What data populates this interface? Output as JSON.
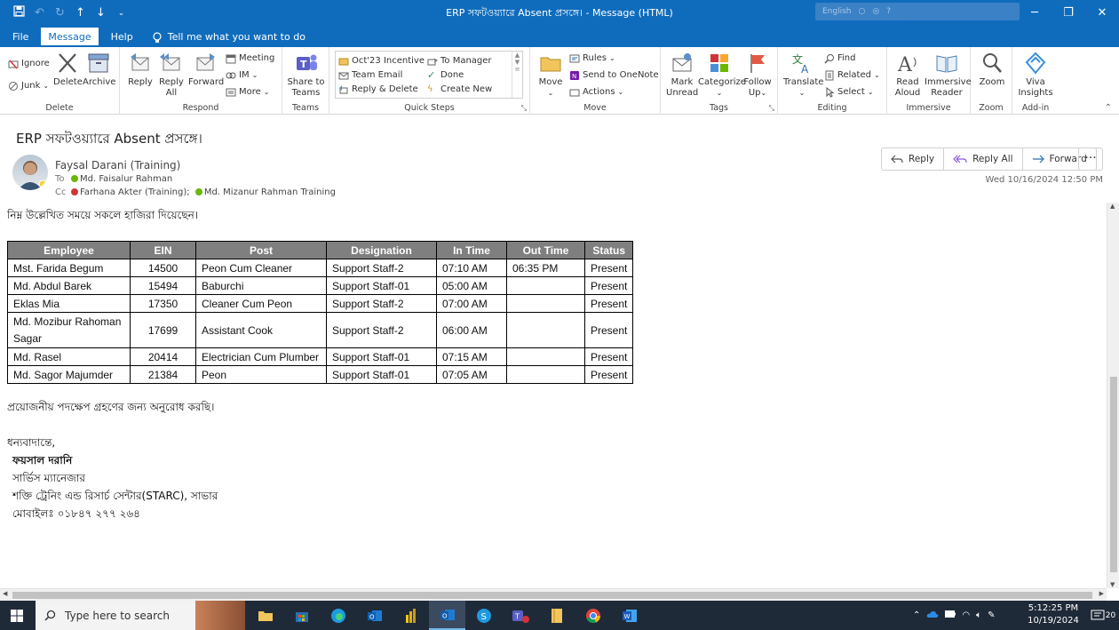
{
  "window": {
    "title": "ERP সফটওয়্যারে Absent প্রসঙ্গে। - Message (HTML)",
    "account_hint": "English"
  },
  "menu": {
    "tabs": [
      "File",
      "Message",
      "Help"
    ],
    "active_tab": "Message",
    "tell_me": "Tell me what you want to do"
  },
  "ribbon": {
    "delete_group": {
      "label": "Delete",
      "ignore": "Ignore",
      "junk": "Junk",
      "delete": "Delete",
      "archive": "Archive"
    },
    "respond_group": {
      "label": "Respond",
      "reply": "Reply",
      "reply_all_1": "Reply",
      "reply_all_2": "All",
      "forward": "Forward",
      "meeting": "Meeting",
      "im": "IM",
      "more": "More"
    },
    "teams_group": {
      "label": "Teams",
      "share_1": "Share to",
      "share_2": "Teams"
    },
    "quicksteps_group": {
      "label": "Quick Steps",
      "items": [
        "Oct'23 Incentive",
        "To Manager",
        "Team Email",
        "Done",
        "Reply & Delete",
        "Create New"
      ]
    },
    "move_group": {
      "label": "Move",
      "move": "Move",
      "rules": "Rules",
      "onenote": "Send to OneNote",
      "actions": "Actions"
    },
    "tags_group": {
      "label": "Tags",
      "mark_1": "Mark",
      "mark_2": "Unread",
      "categorize": "Categorize",
      "follow_1": "Follow",
      "follow_2": "Up"
    },
    "editing_group": {
      "label": "Editing",
      "translate": "Translate",
      "find": "Find",
      "related": "Related",
      "select": "Select"
    },
    "immersive_group": {
      "label": "Immersive",
      "read_1": "Read",
      "read_2": "Aloud",
      "imm_1": "Immersive",
      "imm_2": "Reader"
    },
    "zoom_group": {
      "label": "Zoom",
      "zoom": "Zoom"
    },
    "addin_group": {
      "label": "Add-in",
      "viva_1": "Viva",
      "viva_2": "Insights"
    }
  },
  "message": {
    "subject": "ERP সফটওয়্যারে Absent প্রসঙ্গে।",
    "sender": "Faysal Darani (Training)",
    "to_label": "To",
    "to": "Md. Faisalur Rahman",
    "cc_label": "Cc",
    "cc_1": "Farhana Akter (Training);",
    "cc_2": "Md. Mizanur Rahman Training",
    "timestamp": "Wed 10/16/2024 12:50 PM",
    "actions": {
      "reply": "Reply",
      "reply_all": "Reply All",
      "forward": "Forward",
      "more": "···"
    }
  },
  "body": {
    "intro": "নিম্ন উল্লেখিত সময়ে সকলে হাজিরা দিয়েছেন।",
    "table": {
      "headers": [
        "Employee",
        "EIN",
        "Post",
        "Designation",
        "In Time",
        "Out Time",
        "Status"
      ],
      "rows": [
        [
          "Mst. Farida Begum",
          "14500",
          "Peon Cum Cleaner",
          "Support Staff-2",
          "07:10 AM",
          "06:35 PM",
          "Present"
        ],
        [
          "Md. Abdul Barek",
          "15494",
          "Baburchi",
          "Support Staff-01",
          "05:00 AM",
          "",
          "Present"
        ],
        [
          "Eklas Mia",
          "17350",
          "Cleaner Cum Peon",
          "Support Staff-2",
          "07:00 AM",
          "",
          "Present"
        ],
        [
          "Md. Mozibur Rahoman Sagar",
          "17699",
          "Assistant Cook",
          "Support Staff-2",
          "06:00 AM",
          "",
          "Present"
        ],
        [
          "Md. Rasel",
          "20414",
          "Electrician Cum Plumber",
          "Support Staff-01",
          "07:15 AM",
          "",
          "Present"
        ],
        [
          "Md. Sagor Majumder",
          "21384",
          "Peon",
          "Support Staff-01",
          "07:05 AM",
          "",
          "Present"
        ]
      ]
    },
    "request": "প্রয়োজনীয় পদক্ষেপ গ্রহণের জন্য অনুরোধ করছি।",
    "signature": {
      "greeting": "ধন্যবাদান্তে,",
      "name": "ফয়সাল দরানি",
      "title": "সার্ভিস ম্যানেজার",
      "org": "শক্তি ট্রেনিং এন্ড রিসার্চ সেন্টার(STARC), সাভার",
      "phone": "মোবাইলঃ ০১৮৪৭ ২৭৭ ২৬৪"
    }
  },
  "taskbar": {
    "search_placeholder": "Type here to search",
    "time": "5:12:25 PM",
    "date": "10/19/2024",
    "notifications": "20"
  },
  "colors": {
    "accent": "#0f6cbd",
    "table_header": "#7f7f7f",
    "taskbar": "#1f2a38"
  }
}
